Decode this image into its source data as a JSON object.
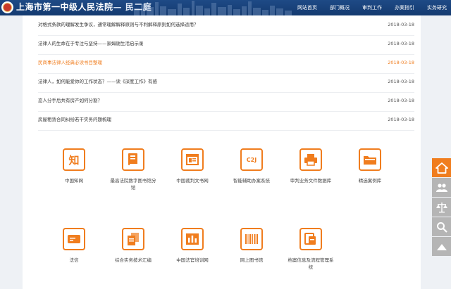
{
  "header": {
    "site_title": "上海市第一中级人民法院",
    "sub_title": "— 民二庭",
    "nav": [
      "网站首页",
      "部门概况",
      "审判工作",
      "办案指引",
      "实务研究"
    ]
  },
  "articles": [
    {
      "title": "对格式条款的理解发生争议，通常理解解释原则与不利解释原则如何选择适用？",
      "date": "2018-03-18",
      "highlight": false
    },
    {
      "title": "法律人的生命在于专注与坚持——家姆谢生活启示录",
      "date": "2018-03-18",
      "highlight": false
    },
    {
      "title": "民商事法律人经典必读书目整理",
      "date": "2018-03-18",
      "highlight": true
    },
    {
      "title": "法律人，如何能爱你的工作状态？——读《深度工作》有感",
      "date": "2018-03-18",
      "highlight": false
    },
    {
      "title": "恋人分手后共有房产如何分割？",
      "date": "2018-03-18",
      "highlight": false
    },
    {
      "title": "房屋租赁合同纠纷若干实务问题梳理",
      "date": "2018-03-18",
      "highlight": false
    }
  ],
  "resources_row1": [
    {
      "label": "中国知网",
      "icon": "zhi-icon",
      "glyph": "知"
    },
    {
      "label": "最高法院数字图书馆分馆",
      "icon": "book-icon",
      "glyph": ""
    },
    {
      "label": "中国裁判文书网",
      "icon": "document-window-icon",
      "glyph": ""
    },
    {
      "label": "智能辅助办案系统",
      "icon": "c2j-icon",
      "glyph": "C2J"
    },
    {
      "label": "审判业务文件数据库",
      "icon": "printer-icon",
      "glyph": ""
    },
    {
      "label": "精选案例库",
      "icon": "folder-icon",
      "glyph": ""
    }
  ],
  "resources_row2": [
    {
      "label": "法信",
      "icon": "card-icon",
      "glyph": ""
    },
    {
      "label": "综合实务技术汇编",
      "icon": "stacked-docs-icon",
      "glyph": ""
    },
    {
      "label": "中国法官培训网",
      "icon": "building-icon",
      "glyph": ""
    },
    {
      "label": "网上图书馆",
      "icon": "barcode-icon",
      "glyph": ""
    },
    {
      "label": "档案信息及流程管理系统",
      "icon": "archive-icon",
      "glyph": ""
    }
  ],
  "sidebar": [
    "home-icon",
    "people-icon",
    "scales-icon",
    "search-icon",
    "up-arrow-icon"
  ],
  "colors": {
    "accent": "#f07d1e",
    "header": "#1a4580",
    "sidebar_inactive": "#b5b5b5"
  }
}
